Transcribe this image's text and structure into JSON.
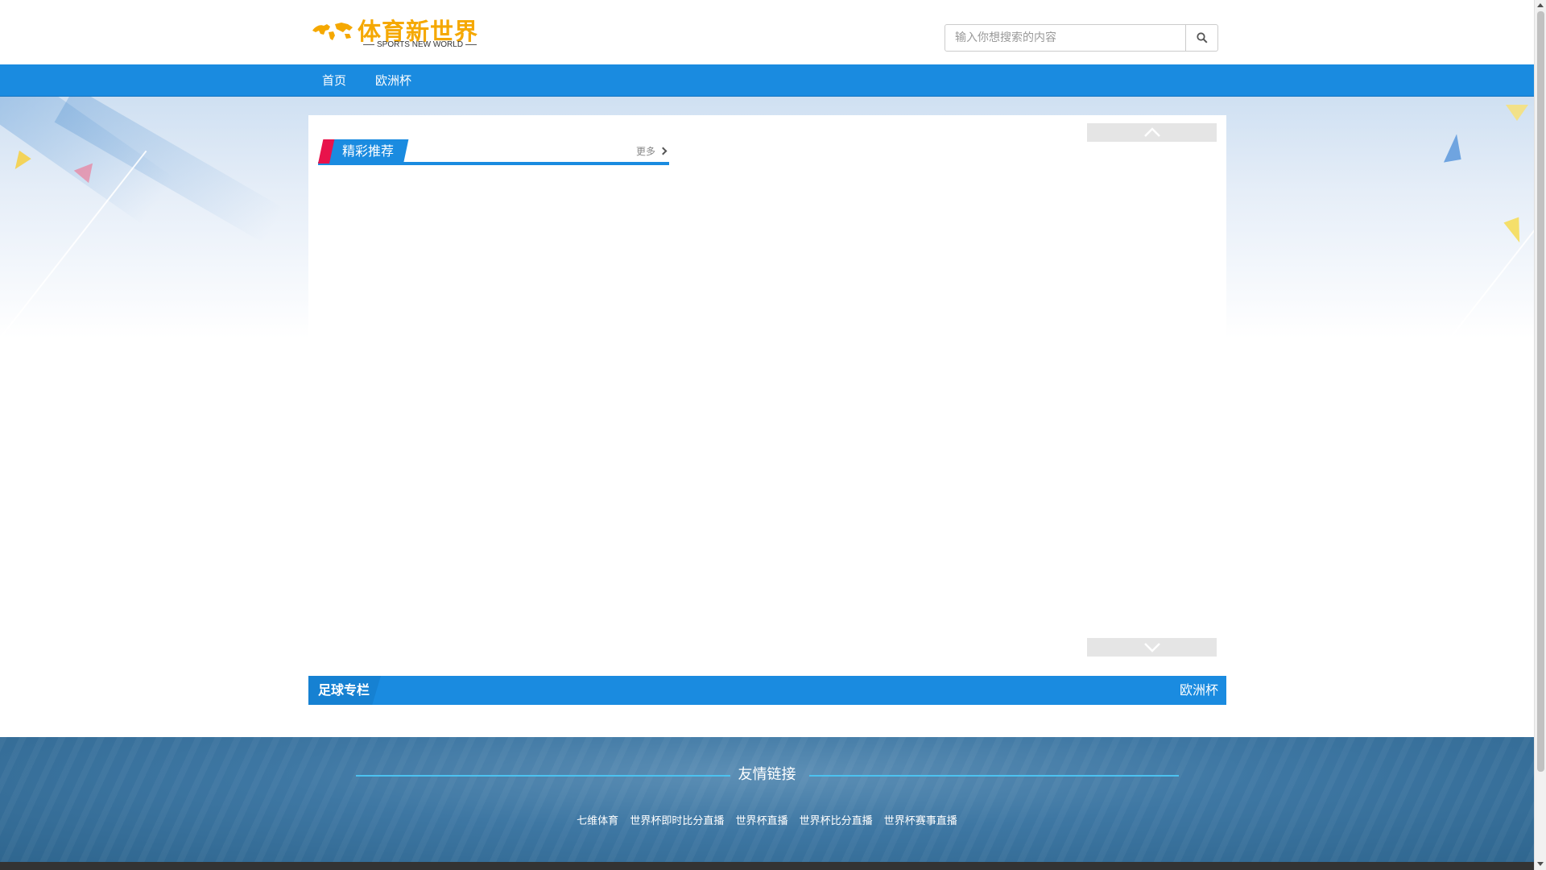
{
  "header": {
    "logo_title": "体育新世界",
    "logo_subtitle": "SPORTS NEW WORLD",
    "logo_color": "#f5a800"
  },
  "search": {
    "placeholder": "输入你想搜索的内容",
    "button_icon": "search-icon"
  },
  "nav": {
    "items": [
      {
        "label": "首页"
      },
      {
        "label": "欧洲杯"
      }
    ],
    "color": "#1a8be0"
  },
  "featured": {
    "title": "精彩推荐",
    "more_label": "更多",
    "up_icon": "chevron-up-icon",
    "down_icon": "chevron-down-icon"
  },
  "football": {
    "title": "足球专栏",
    "link": "欧洲杯"
  },
  "footer": {
    "friend_links_title": "友情链接",
    "links": [
      {
        "label": "七维体育"
      },
      {
        "label": "世界杯即时比分直播"
      },
      {
        "label": "世界杯直播"
      },
      {
        "label": "世界杯比分直播"
      },
      {
        "label": "世界杯赛事直播"
      }
    ]
  }
}
